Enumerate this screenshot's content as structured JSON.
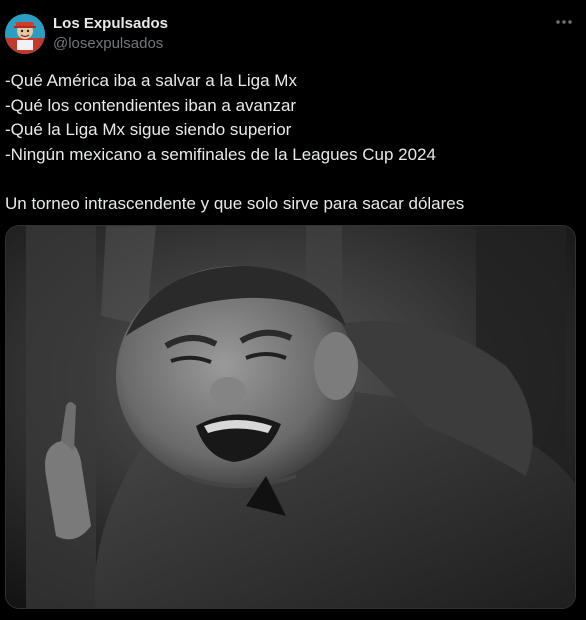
{
  "author": {
    "display_name": "Los Expulsados",
    "handle": "@losexpulsados",
    "avatar_icon": "avatar-image"
  },
  "more_icon": "more-horizontal-icon",
  "tweet": {
    "lines": [
      "-Qué América iba a salvar a la Liga Mx",
      "-Qué los contendientes iban a avanzar",
      "-Qué la Liga Mx sigue siendo superior",
      "-Ningún mexicano a semifinales de la Leagues Cup 2024",
      "Un torneo intrascendente y que solo sirve para sacar dólares"
    ]
  },
  "media": {
    "type": "photo",
    "tone": "black-and-white"
  },
  "colors": {
    "background": "#000000",
    "text_primary": "#e7e9ea",
    "text_secondary": "#71767b",
    "border": "#2f3336"
  }
}
